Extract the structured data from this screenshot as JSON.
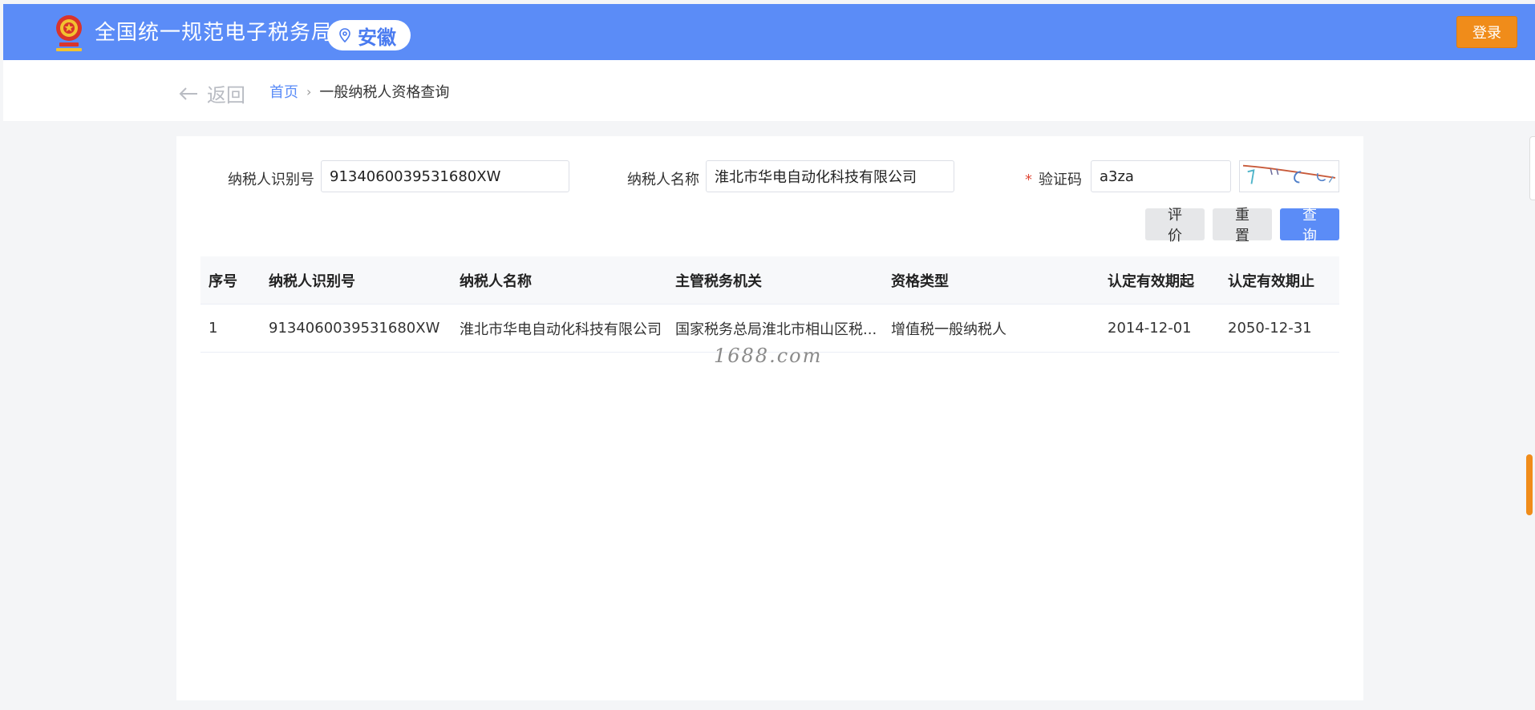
{
  "header": {
    "site_title": "全国统一规范电子税务局",
    "region": "安徽",
    "login_label": "登录",
    "brand_color": "#5b8cf7",
    "login_color": "#f08c1a"
  },
  "subheader": {
    "back_label": "返回",
    "breadcrumb": {
      "home": "首页",
      "separator": "›",
      "current": "一般纳税人资格查询"
    }
  },
  "form": {
    "taxpayer_id": {
      "label": "纳税人识别号",
      "value": "9134060039531680XW"
    },
    "taxpayer_name": {
      "label": "纳税人名称",
      "value": "淮北市华电自动化科技有限公司"
    },
    "captcha": {
      "required_mark": "*",
      "label": "验证码",
      "value": "a3za"
    }
  },
  "actions": {
    "evaluate": "评价",
    "reset": "重置",
    "query": "查询"
  },
  "table": {
    "headers": [
      "序号",
      "纳税人识别号",
      "纳税人名称",
      "主管税务机关",
      "资格类型",
      "认定有效期起",
      "认定有效期止"
    ],
    "rows": [
      [
        "1",
        "9134060039531680XW",
        "淮北市华电自动化科技有限公司",
        "国家税务总局淮北市相山区税...",
        "增值税一般纳税人",
        "2014-12-01",
        "2050-12-31"
      ]
    ]
  },
  "watermark": "1688.com"
}
